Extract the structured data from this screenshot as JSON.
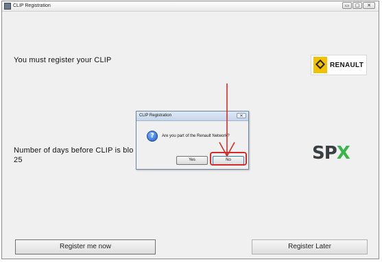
{
  "window": {
    "title": "CLIP Registration",
    "controls": {
      "minimize": "▭",
      "maximize": "▢",
      "close": "✕"
    }
  },
  "main": {
    "register_message": "You must register your CLIP",
    "days_label": "Number of days before CLIP is blo",
    "days_value": "25",
    "register_now_label": "Register me now",
    "register_later_label": "Register Later"
  },
  "logos": {
    "renault_word": "RENAULT",
    "spx_letters": "SP",
    "spx_x": "X"
  },
  "dialog": {
    "title": "CLIP Registration",
    "close": "✕",
    "icon": "question-icon",
    "icon_glyph": "?",
    "message": "Are you part of the Renault Network?",
    "yes_label": "Yes",
    "no_label": "No"
  },
  "annotation": {
    "color": "#d42a2a"
  }
}
